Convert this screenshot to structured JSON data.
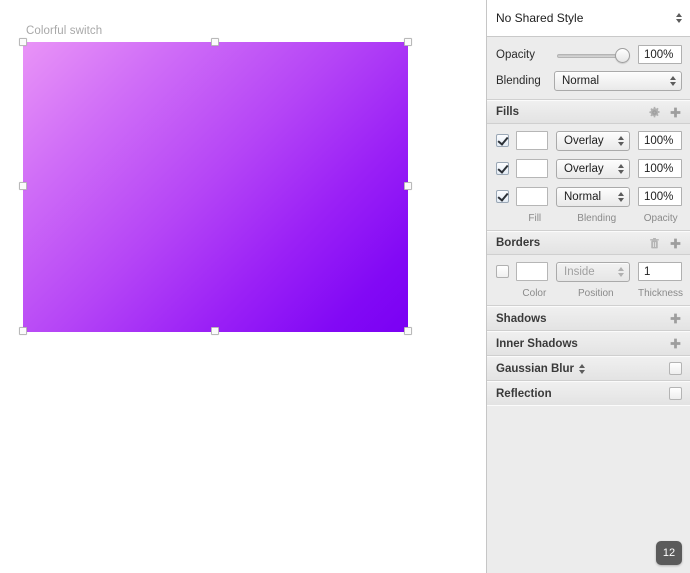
{
  "canvas": {
    "artboard_label": "Colorful switch",
    "shape": {
      "gradient_start": "#e994f7",
      "gradient_end": "#7a00f4",
      "selected": true
    }
  },
  "inspector": {
    "shared_style": {
      "value": "No Shared Style",
      "stepper_icon": "stepper-icon"
    },
    "opacity": {
      "label": "Opacity",
      "value": "100%",
      "slider_position": "100"
    },
    "blending": {
      "label": "Blending",
      "value": "Normal"
    },
    "fills": {
      "title": "Fills",
      "gear_icon": "gear-icon",
      "add_icon": "plus-icon",
      "columns": {
        "fill": "Fill",
        "blending": "Blending",
        "opacity": "Opacity"
      },
      "rows": [
        {
          "checked": true,
          "swatch": "gradient-dark",
          "blending": "Overlay",
          "opacity": "100%"
        },
        {
          "checked": true,
          "swatch": "gradient-light",
          "blending": "Overlay",
          "opacity": "100%"
        },
        {
          "checked": true,
          "swatch": "solid-purple",
          "blending": "Normal",
          "opacity": "100%",
          "color": "#a626f5"
        }
      ]
    },
    "borders": {
      "title": "Borders",
      "delete_icon": "trash-icon",
      "add_icon": "plus-icon",
      "columns": {
        "color": "Color",
        "position": "Position",
        "thickness": "Thickness"
      },
      "row": {
        "checked": false,
        "swatch": "solid-gray",
        "position": "Inside",
        "position_disabled": true,
        "thickness": "1"
      }
    },
    "shadows": {
      "title": "Shadows",
      "add_icon": "plus-icon"
    },
    "inner_shadows": {
      "title": "Inner Shadows",
      "add_icon": "plus-icon"
    },
    "gaussian_blur": {
      "title": "Gaussian Blur",
      "stepper_icon": "stepper-icon",
      "checked": false
    },
    "reflection": {
      "title": "Reflection",
      "checked": false
    }
  },
  "status": {
    "zoom_badge": "12"
  }
}
